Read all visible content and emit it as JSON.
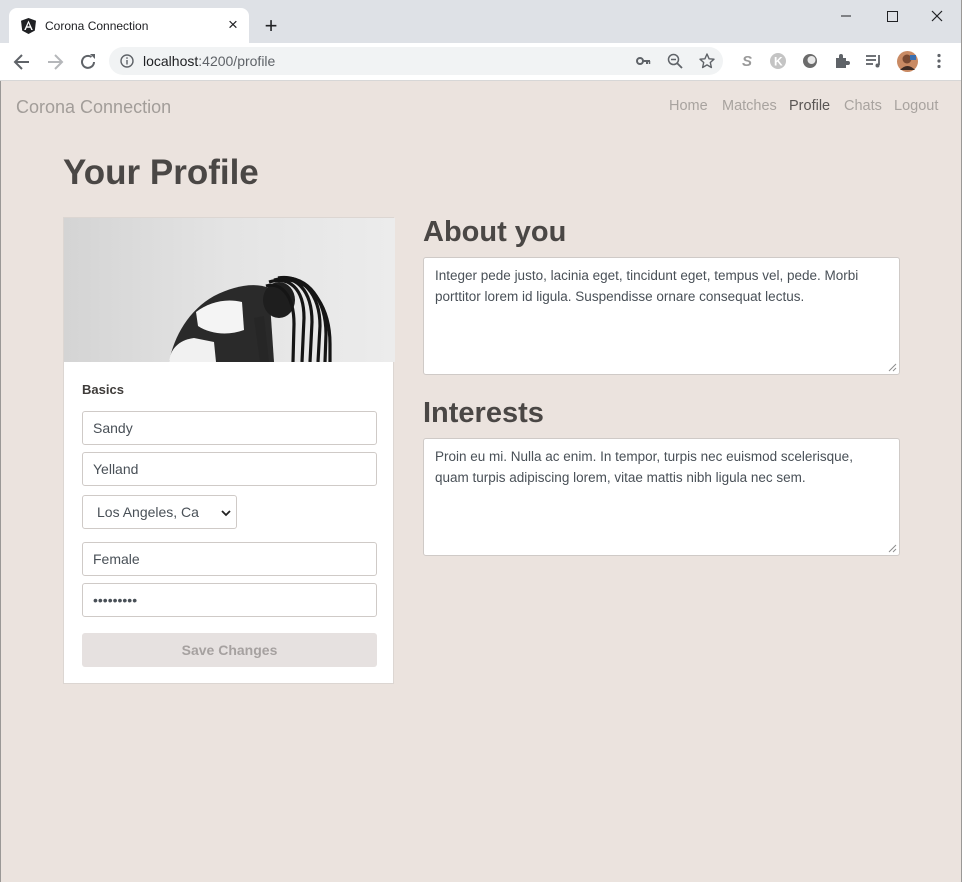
{
  "browser": {
    "tab_title": "Corona Connection",
    "url_host": "localhost",
    "url_rest": ":4200/profile",
    "new_tab": "+",
    "close_tab": "×"
  },
  "nav": {
    "brand": "Corona Connection",
    "links": [
      "Home",
      "Matches",
      "Profile",
      "Chats",
      "Logout"
    ],
    "active": "Profile"
  },
  "page": {
    "title": "Your Profile"
  },
  "basics": {
    "heading": "Basics",
    "first_name": "Sandy",
    "last_name": "Yelland",
    "location": "Los Angeles, Ca",
    "gender": "Female",
    "password_mask": "•••••••••",
    "save_label": "Save Changes"
  },
  "about": {
    "heading": "About you",
    "text": "Integer pede justo, lacinia eget, tincidunt eget, tempus vel, pede. Morbi porttitor lorem id ligula. Suspendisse ornare consequat lectus."
  },
  "interests": {
    "heading": "Interests",
    "text": "Proin eu mi. Nulla ac enim. In tempor, turpis nec euismod scelerisque, quam turpis adipiscing lorem, vitae mattis nibh ligula nec sem."
  },
  "colors": {
    "page_bg": "#ebe3de",
    "heading": "#4a4745",
    "brand": "#a29d99"
  }
}
